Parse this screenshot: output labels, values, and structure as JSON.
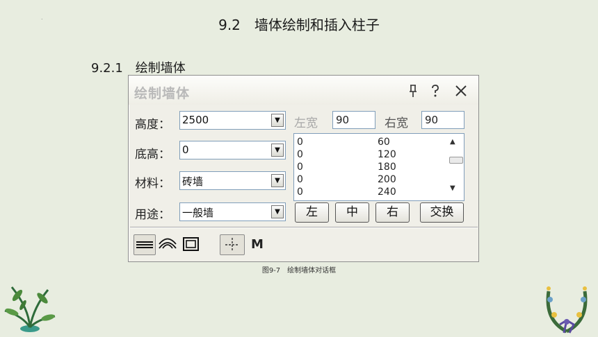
{
  "slide": {
    "title": "9.2　墙体绘制和插入柱子",
    "section_heading": "9.2.1　绘制墙体",
    "caption": "图9-7　绘制墙体对话框",
    "dot": "."
  },
  "dialog": {
    "title": "绘制墙体",
    "icons": {
      "pin": "pin-icon",
      "help": "help-icon",
      "close": "close-icon"
    },
    "icon_glyphs": {
      "pin": "ᵖ",
      "help": "?",
      "close": "✕"
    },
    "fields": {
      "height": {
        "label": "高度：",
        "value": "2500"
      },
      "base_height": {
        "label": "底高：",
        "value": "0"
      },
      "material": {
        "label": "材料：",
        "value": "砖墙"
      },
      "usage": {
        "label": "用途：",
        "value": "一般墙"
      }
    },
    "left_width": {
      "label": "左宽",
      "value": "90"
    },
    "right_width": {
      "label": "右宽",
      "value": "90"
    },
    "list_rows": [
      {
        "c1": "0",
        "c2": "60"
      },
      {
        "c1": "0",
        "c2": "120"
      },
      {
        "c1": "0",
        "c2": "180"
      },
      {
        "c1": "0",
        "c2": "200"
      },
      {
        "c1": "0",
        "c2": "240"
      }
    ],
    "buttons": {
      "left": "左",
      "center": "中",
      "right": "右",
      "swap": "交换"
    },
    "toolbar": {
      "items": [
        "continuous-wall-icon",
        "arc-wall-icon",
        "rectangle-wall-icon",
        "snap-crosshair-icon"
      ],
      "m_label": "M"
    },
    "colors": {
      "title_text": "#b9b9b9",
      "border": "#7f9db9",
      "background": "#f0efe8"
    }
  }
}
